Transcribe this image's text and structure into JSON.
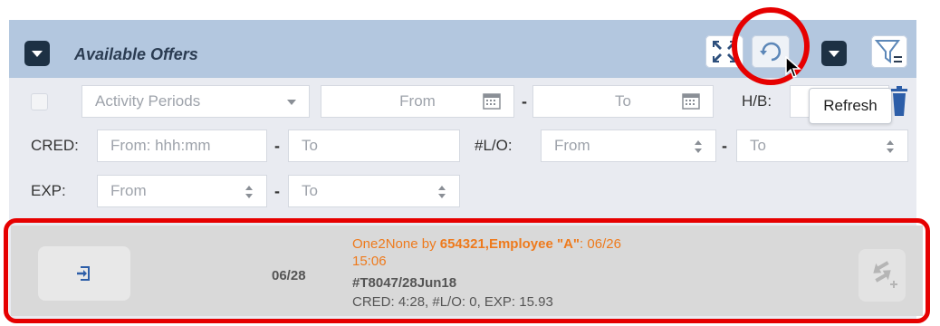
{
  "header": {
    "title": "Available Offers",
    "icons": [
      "collapse-arrows-icon",
      "refresh-icon",
      "dropdown-caret-icon",
      "filter-equals-icon"
    ]
  },
  "tooltip": {
    "text": "Refresh"
  },
  "filters": {
    "activity_periods": {
      "placeholder": "Activity Periods"
    },
    "date_from": {
      "placeholder": "From"
    },
    "date_to": {
      "placeholder": "To"
    },
    "hb_label": "H/B:",
    "cred_label": "CRED:",
    "cred_from": {
      "placeholder": "From: hhh:mm"
    },
    "cred_to": {
      "placeholder": "To"
    },
    "lo_label": "#L/O:",
    "lo_from": {
      "placeholder": "From"
    },
    "lo_to": {
      "placeholder": "To"
    },
    "exp_label": "EXP:",
    "exp_from": {
      "placeholder": "From"
    },
    "exp_to": {
      "placeholder": "To"
    },
    "dash": "-"
  },
  "offer": {
    "date": "06/28",
    "title_prefix": "One2None by ",
    "title_emp": "654321,Employee \"A\"",
    "title_suffix": ": 06/26",
    "title_time": "15:06",
    "trip": "#T8047/28Jun18",
    "stats": "CRED: 4:28, #L/O: 0, EXP: 15.93"
  },
  "colors": {
    "header_bg": "#b3c7df",
    "panel_bg": "#e9ebf1",
    "accent_orange": "#ee7a1c",
    "highlight_red": "#e60000"
  }
}
